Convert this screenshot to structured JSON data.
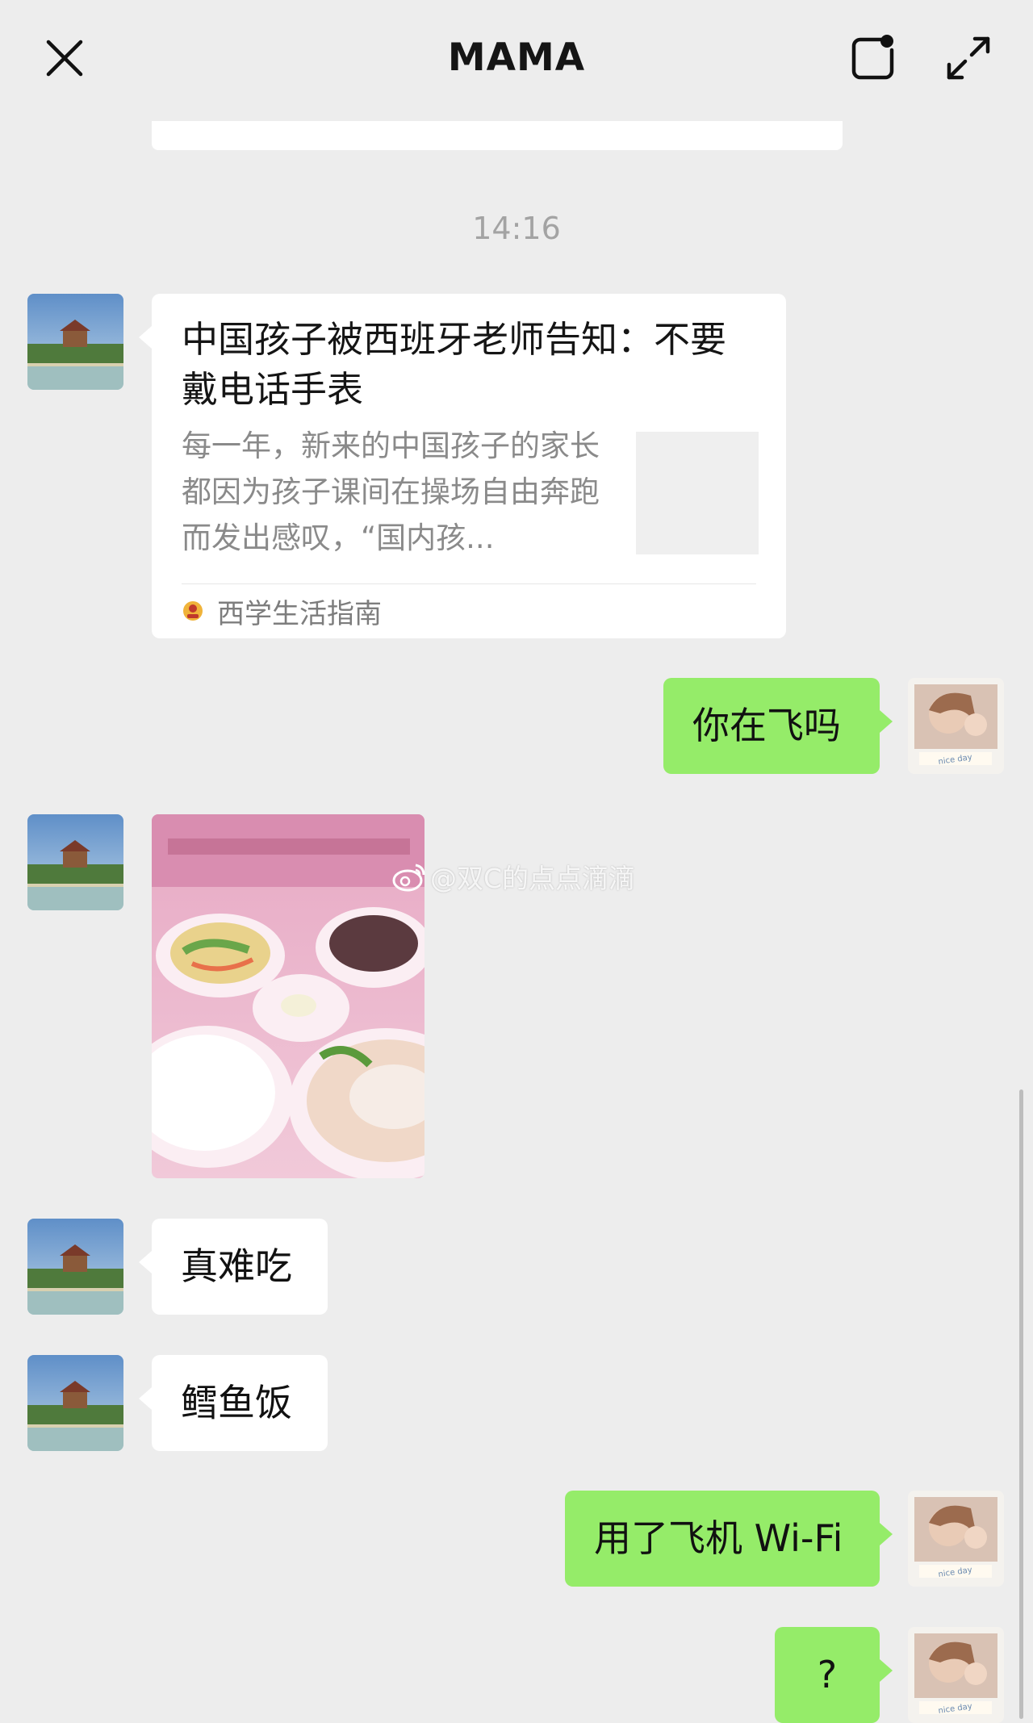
{
  "header": {
    "title": "MAMA",
    "close_icon": "close-icon",
    "float_icon": "float-window-icon",
    "expand_icon": "expand-icon"
  },
  "timestamp": "14:16",
  "article": {
    "title": "中国孩子被西班牙老师告知：不要戴电话手表",
    "description": "每一年，新来的中国孩子的家长都因为孩子课间在操场自由奔跑而发出感叹，“国内孩...",
    "source": "西学生活指南"
  },
  "messages": [
    {
      "side": "right",
      "text": "你在飞吗"
    },
    {
      "side": "left",
      "type": "image",
      "alt": "airline meal photo"
    },
    {
      "side": "left",
      "text": "真难吃"
    },
    {
      "side": "left",
      "text": "鳕鱼饭"
    },
    {
      "side": "right",
      "text": "用了飞机 Wi-Fi"
    },
    {
      "side": "right",
      "text": "?"
    }
  ],
  "watermark": "@双C的点点滴滴",
  "colors": {
    "background": "#ededed",
    "sent_bubble": "#95ec69",
    "received_bubble": "#ffffff",
    "timestamp": "#a3a3a3"
  }
}
